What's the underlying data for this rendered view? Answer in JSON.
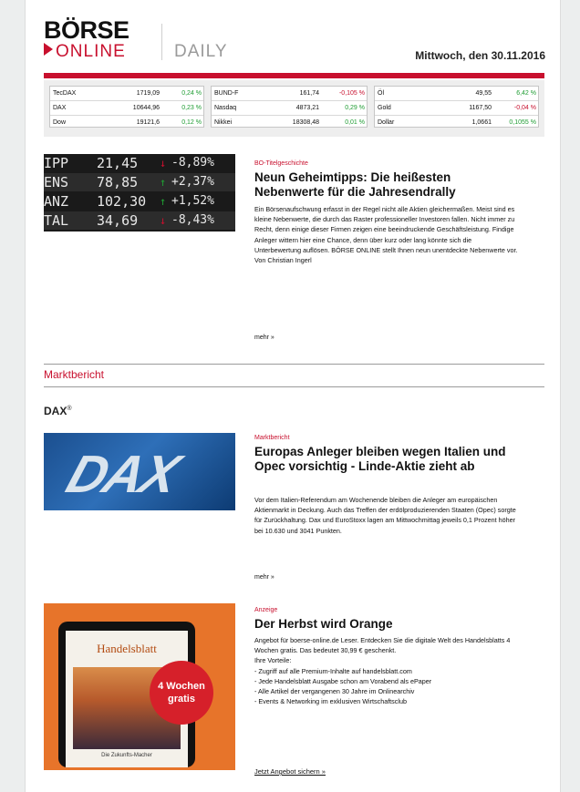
{
  "header": {
    "logo_top": "BÖRSE",
    "logo_bottom": "ONLINE",
    "logo_product": "DAILY",
    "date": "Mittwoch, den 30.11.2016",
    "accent_color": "#c8102e"
  },
  "ticker": {
    "columns": [
      [
        {
          "name": "TecDAX",
          "value": "1719,09",
          "change": "0,24 %",
          "dir": "pos"
        },
        {
          "name": "DAX",
          "value": "10644,96",
          "change": "0,23 %",
          "dir": "pos"
        },
        {
          "name": "Dow",
          "value": "19121,6",
          "change": "0,12 %",
          "dir": "pos"
        }
      ],
      [
        {
          "name": "BUND-F",
          "value": "161,74",
          "change": "-0,105 %",
          "dir": "neg"
        },
        {
          "name": "Nasdaq",
          "value": "4873,21",
          "change": "0,29 %",
          "dir": "pos"
        },
        {
          "name": "Nikkei",
          "value": "18308,48",
          "change": "0,01 %",
          "dir": "pos"
        }
      ],
      [
        {
          "name": "Öl",
          "value": "49,55",
          "change": "6,42 %",
          "dir": "pos"
        },
        {
          "name": "Gold",
          "value": "1167,50",
          "change": "-0,04 %",
          "dir": "neg"
        },
        {
          "name": "Dollar",
          "value": "1,0661",
          "change": "0,1055 %",
          "dir": "pos"
        }
      ]
    ]
  },
  "article1": {
    "board_rows": [
      {
        "sym": "IPP",
        "price": "21,45",
        "arrow": "↓",
        "pct": "-8,89%",
        "dir": "neg"
      },
      {
        "sym": "ENS",
        "price": "78,85",
        "arrow": "↑",
        "pct": "+2,37%",
        "dir": "pos"
      },
      {
        "sym": "ANZ",
        "price": "102,30",
        "arrow": "↑",
        "pct": "+1,52%",
        "dir": "pos"
      },
      {
        "sym": "TAL",
        "price": "34,69",
        "arrow": "↓",
        "pct": "-8,43%",
        "dir": "neg"
      }
    ],
    "kicker": "BO-Titelgeschichte",
    "headline": "Neun Geheimtipps: Die heißesten Nebenwerte für die Jahresendrally",
    "teaser": "Ein Börsenaufschwung erfasst in der Regel nicht alle Aktien gleichermaßen. Meist sind es kleine Nebenwerte, die durch das Raster professioneller Investoren fallen. Nicht immer zu Recht, denn einige dieser Firmen zeigen eine beeindruckende Geschäftsleistung. Findige Anleger wittern hier eine Chance, denn über kurz oder lang könnte sich die Unterbewertung auflösen. BÖRSE ONLINE stellt Ihnen neun unentdeckte Nebenwerte vor. Von Christian Ingerl",
    "more": "mehr »"
  },
  "section": {
    "title": "Marktbericht",
    "subtitle": "DAX",
    "subtitle_sup": "®"
  },
  "article2": {
    "image_text": "DAX",
    "kicker": "Marktbericht",
    "headline": "Europas Anleger bleiben wegen Italien und Opec vorsichtig - Linde-Aktie zieht ab",
    "teaser": "Vor dem Italien-Referendum am Wochenende bleiben die Anleger am europäischen Aktienmarkt in Deckung. Auch das Treffen der erdölproduzierenden Staaten (Opec) sorgte für Zurückhaltung. Dax und EuroStoxx lagen am Mittwochmittag jeweils 0,1 Prozent höher bei 10.630 und 3041 Punkten.",
    "more": "mehr »"
  },
  "ad": {
    "tablet_title": "Handelsblatt",
    "tablet_sub": "Die Zukunfts-Macher",
    "badge_line1": "4 Wochen",
    "badge_line2": "gratis",
    "kicker": "Anzeige",
    "headline": "Der Herbst wird Orange",
    "teaser_lines": [
      "Angebot für boerse-online.de Leser. Entdecken Sie die digitale Welt des Handelsblatts 4 Wochen gratis. Das bedeutet 30,99 € geschenkt.",
      "Ihre Vorteile:",
      "- Zugriff auf alle Premium-Inhalte auf handelsblatt.com",
      "- Jede Handelsblatt Ausgabe schon am Vorabend als ePaper",
      "- Alle Artikel der vergangenen 30 Jahre im Onlinearchiv",
      "- Events & Networking im exklusiven Wirtschaftsclub"
    ],
    "cta": "Jetzt Angebot sichern »"
  }
}
